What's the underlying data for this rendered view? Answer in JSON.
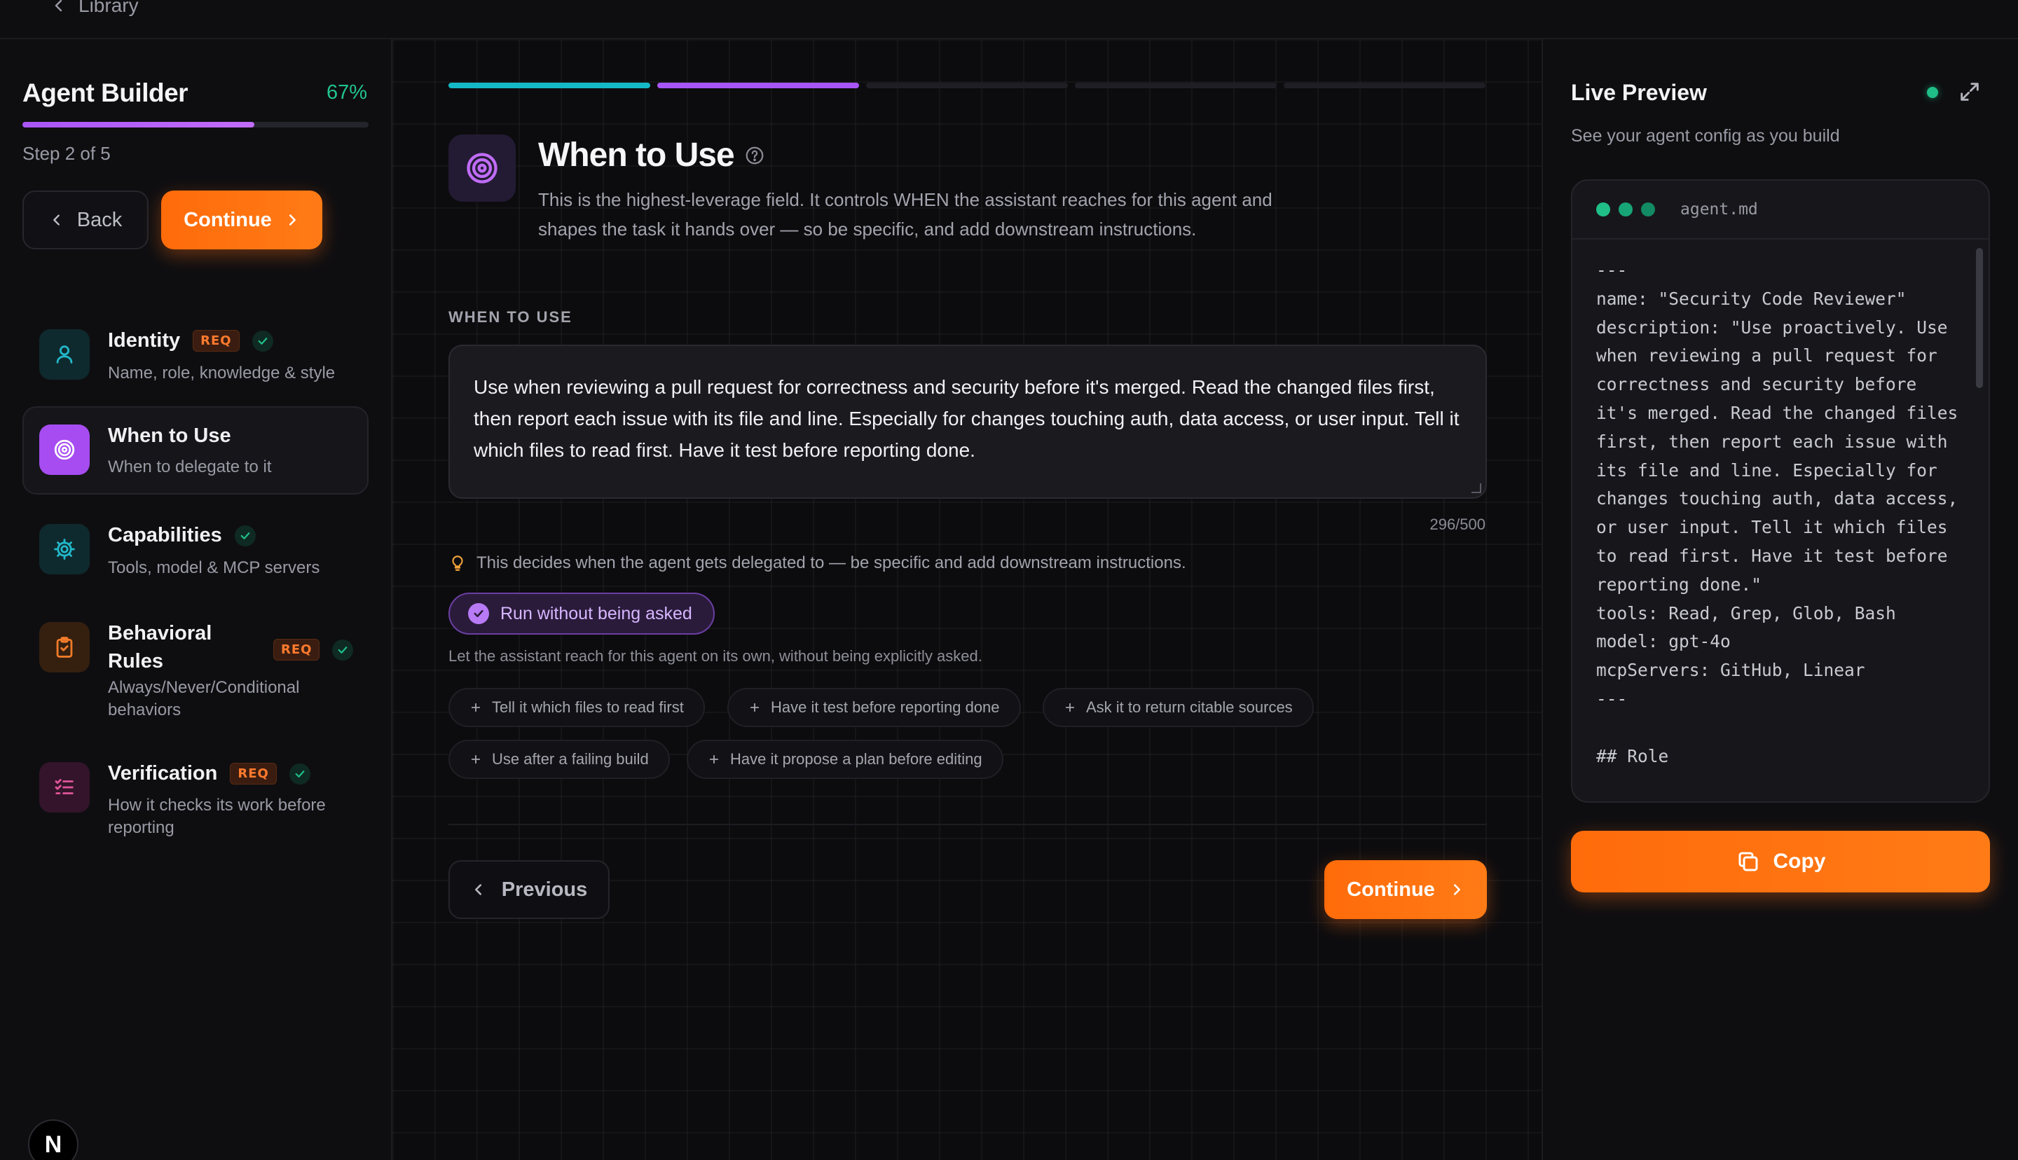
{
  "topbar": {
    "back_label": "Library"
  },
  "sidebar": {
    "title": "Agent Builder",
    "progress_pct_label": "67%",
    "progress_fraction": 0.67,
    "step_label": "Step 2 of 5",
    "back_label": "Back",
    "continue_label": "Continue",
    "items": [
      {
        "title": "Identity",
        "req": "REQ",
        "done": true,
        "sub": "Name, role, knowledge & style",
        "icon": "user-icon",
        "color": "#22b8c9"
      },
      {
        "title": "When to Use",
        "req": "",
        "done": false,
        "sub": "When to delegate to it",
        "icon": "target-icon",
        "color": "#b35cf5"
      },
      {
        "title": "Capabilities",
        "req": "",
        "done": true,
        "sub": "Tools, model & MCP servers",
        "icon": "gear-icon",
        "color": "#22b8c9"
      },
      {
        "title": "Behavioral Rules",
        "req": "REQ",
        "done": true,
        "sub": "Always/Never/Conditional behaviors",
        "icon": "clipboard-icon",
        "color": "#f07b2a"
      },
      {
        "title": "Verification",
        "req": "REQ",
        "done": true,
        "sub": "How it checks its work before reporting",
        "icon": "checklist-icon",
        "color": "#e0559a"
      }
    ],
    "logo_letter": "N"
  },
  "main": {
    "step_segments": [
      {
        "state": "done",
        "color": "#14b8c6"
      },
      {
        "state": "active",
        "color": "#a855f7"
      },
      {
        "state": "pending",
        "color": "#1e1e24"
      },
      {
        "state": "pending",
        "color": "#1e1e24"
      },
      {
        "state": "pending",
        "color": "#1e1e24"
      }
    ],
    "title": "When to Use",
    "description": "This is the highest-leverage field. It controls WHEN the assistant reaches for this agent and shapes the task it hands over — so be specific, and add downstream instructions.",
    "field_label": "WHEN TO USE",
    "field_value": "Use when reviewing a pull request for correctness and security before it's merged. Read the changed files first, then report each issue with its file and line. Especially for changes touching auth, data access, or user input. Tell it which files to read first. Have it test before reporting done.",
    "counter": "296/500",
    "hint": "This decides when the agent gets delegated to — be specific and add downstream instructions.",
    "toggle_label": "Run without being asked",
    "toggle_checked": true,
    "toggle_help": "Let the assistant reach for this agent on its own, without being explicitly asked.",
    "chips": [
      "Tell it which files to read first",
      "Have it test before reporting done",
      "Ask it to return citable sources",
      "Use after a failing build",
      "Have it propose a plan before editing"
    ],
    "previous_label": "Previous",
    "continue_label": "Continue"
  },
  "preview": {
    "title": "Live Preview",
    "subtitle": "See your agent config as you build",
    "filename": "agent.md",
    "code": "---\nname: \"Security Code Reviewer\"\ndescription: \"Use proactively. Use\nwhen reviewing a pull request for\ncorrectness and security before\nit's merged. Read the changed files\nfirst, then report each issue with\nits file and line. Especially for\nchanges touching auth, data access,\nor user input. Tell it which files\nto read first. Have it test before\nreporting done.\"\ntools: Read, Grep, Glob, Bash\nmodel: gpt-4o\nmcpServers: GitHub, Linear\n---\n\n## Role",
    "copy_label": "Copy",
    "status_color": "#1fbf87"
  }
}
